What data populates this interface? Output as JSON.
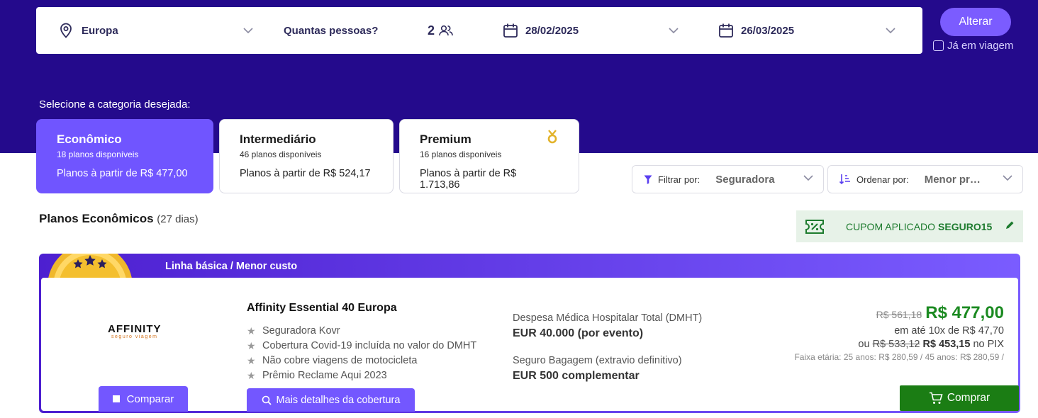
{
  "search": {
    "destination": "Europa",
    "people_label": "Quantas pessoas?",
    "people_count": "2",
    "date_start": "28/02/2025",
    "date_end": "26/03/2025",
    "alter_button": "Alterar",
    "already_traveling": "Já em viagem"
  },
  "categories": {
    "prompt": "Selecione a categoria desejada:",
    "items": [
      {
        "name": "Econômico",
        "count": "18 planos disponíveis",
        "price": "Planos à partir de R$ 477,00",
        "active": true
      },
      {
        "name": "Intermediário",
        "count": "46 planos disponíveis",
        "price": "Planos à partir de R$ 524,17",
        "active": false
      },
      {
        "name": "Premium",
        "count": "16 planos disponíveis",
        "price": "Planos à partir de R$ 1.713,86",
        "active": false
      }
    ]
  },
  "filters": {
    "filter_label": "Filtrar por:",
    "filter_value": "Seguradora",
    "sort_label": "Ordenar por:",
    "sort_value": "Menor preço"
  },
  "plans_header": {
    "title": "Planos Econômicos",
    "days": "(27 dias)"
  },
  "coupon": {
    "text": "CUPOM APLICADO",
    "code": "SEGURO15"
  },
  "plan": {
    "line": "Linha básica / Menor custo",
    "logo_main": "AFFINITY",
    "logo_sub": "seguro viagem",
    "name": "Affinity Essential 40 Europa",
    "features": [
      "Seguradora Kovr",
      "Cobertura Covid-19 incluída no valor do DMHT",
      "Não cobre viagens de motocicleta",
      "Prêmio Reclame Aqui 2023"
    ],
    "compare_button": "Comparar",
    "details_button": "Mais detalhes da cobertura",
    "coverage": [
      {
        "label": "Despesa Médica Hospitalar Total (DMHT)",
        "amount": "EUR 40.000 (por evento)"
      },
      {
        "label": "Seguro Bagagem (extravio definitivo)",
        "amount": "EUR 500 complementar"
      }
    ],
    "price_old": "R$ 561,18",
    "price_main": "R$ 477,00",
    "installments": "em até 10x de R$ 47,70",
    "pix_prefix": "ou",
    "pix_old": "R$ 533,12",
    "pix_new": "R$ 453,15",
    "pix_suffix": "no PIX",
    "age_range": "Faixa etária: 25 anos: R$ 280,59 / 45 anos: R$ 280,59 /",
    "buy_button": "Comprar"
  },
  "colors": {
    "hero": "#240a8c",
    "accent": "#7055ff",
    "price_green": "#1b8a21",
    "buy_green": "#1b7d14"
  }
}
